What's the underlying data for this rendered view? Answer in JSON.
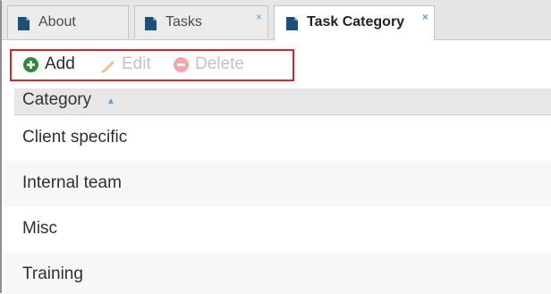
{
  "tabs": [
    {
      "label": "About",
      "closable": false,
      "active": false
    },
    {
      "label": "Tasks",
      "closable": true,
      "active": false
    },
    {
      "label": "Task Category",
      "closable": true,
      "active": true
    }
  ],
  "tab_close_glyph": "×",
  "toolbar": {
    "add_label": "Add",
    "edit_label": "Edit",
    "delete_label": "Delete",
    "add_icon": "plus-circle-icon",
    "edit_icon": "pencil-icon",
    "delete_icon": "minus-circle-icon"
  },
  "grid": {
    "column_header": "Category",
    "sort_direction": "ascending",
    "sort_glyph": "▲",
    "rows": [
      "Client specific",
      "Internal team",
      "Misc",
      "Training"
    ]
  },
  "colors": {
    "add_icon": "#2e8b3a",
    "disabled": "#c2c2c2",
    "edit_icon": "#f0c27a",
    "delete_icon": "#f2a7a7",
    "highlight_box": "#d9242f",
    "close_x": "#5aa0d8"
  }
}
